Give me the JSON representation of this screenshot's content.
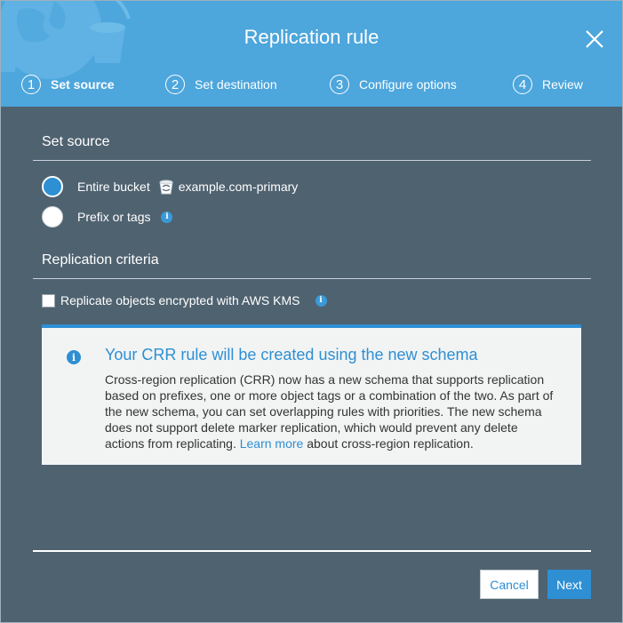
{
  "modal": {
    "title": "Replication rule",
    "close_icon": "close-icon"
  },
  "steps": [
    {
      "number": "1",
      "label": "Set source",
      "active": true
    },
    {
      "number": "2",
      "label": "Set destination",
      "active": false
    },
    {
      "number": "3",
      "label": "Configure options",
      "active": false
    },
    {
      "number": "4",
      "label": "Review",
      "active": false
    }
  ],
  "set_source": {
    "title": "Set source",
    "options": [
      {
        "label": "Entire bucket",
        "bucket_name": "example.com-primary",
        "checked": true,
        "icon": "bucket-icon"
      },
      {
        "label": "Prefix or tags",
        "checked": false,
        "icon": "info-icon"
      }
    ]
  },
  "replication_criteria": {
    "title": "Replication criteria",
    "kms_checkbox_label": "Replicate objects encrypted with AWS KMS",
    "kms_checked": false
  },
  "alert": {
    "title": "Your CRR rule will be created using the new schema",
    "body_before_link": "Cross-region replication (CRR) now has a new schema that supports replication based on prefixes, one or more object tags or a combination of the two. As part of the new schema, you can set overlapping rules with priorities. The new schema does not support delete marker replication, which would prevent any delete actions from replicating.",
    "link_text": "Learn more",
    "body_after_link": "about cross-region replication."
  },
  "footer": {
    "cancel_label": "Cancel",
    "next_label": "Next"
  },
  "colors": {
    "header": "#4da6dc",
    "body_bg": "#4f6270",
    "accent": "#2e8fd3"
  }
}
